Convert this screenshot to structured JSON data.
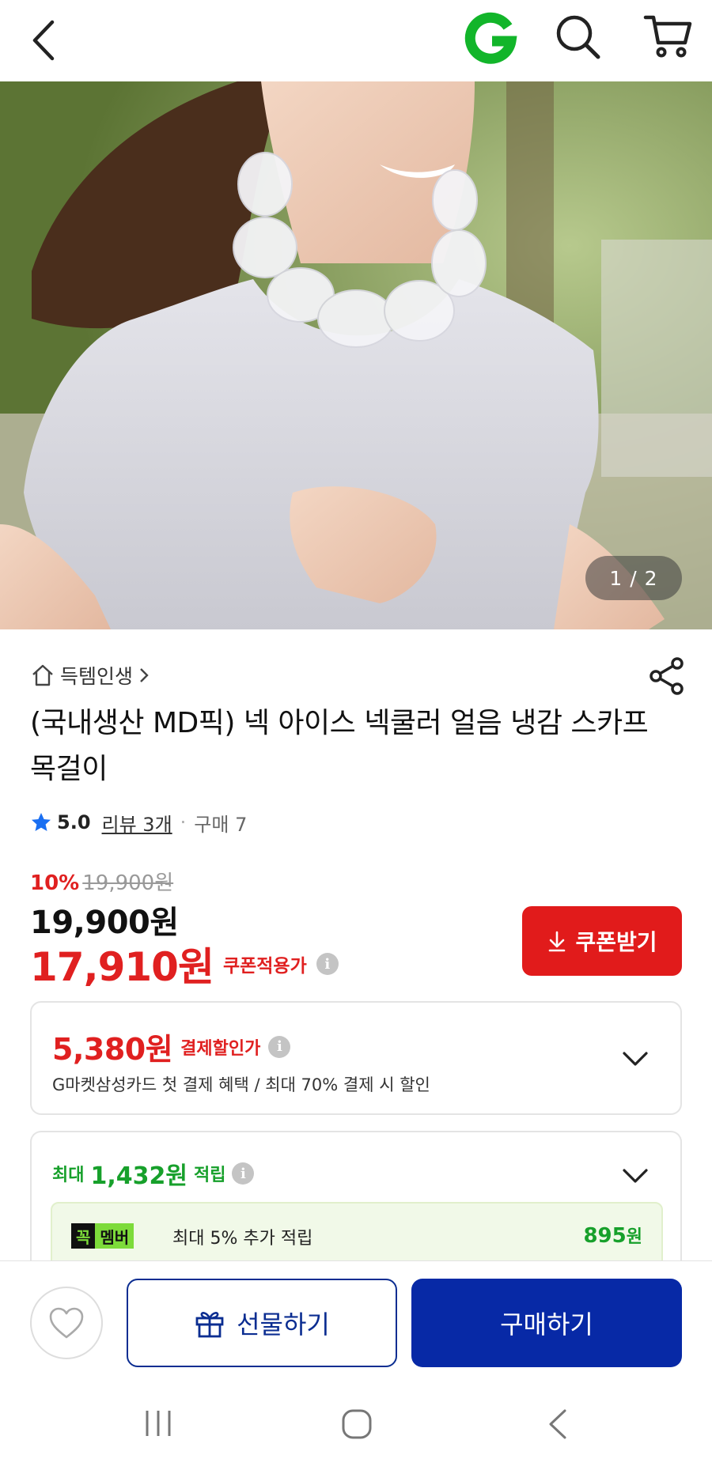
{
  "header": {
    "back_icon": "back-arrow-icon",
    "logo_icon": "g-logo-icon",
    "search_icon": "search-icon",
    "cart_icon": "cart-icon",
    "logo_color": "#12b52a"
  },
  "hero": {
    "counter": "1 / 2"
  },
  "seller": {
    "name": "득템인생",
    "home_icon": "home-icon",
    "share_icon": "share-icon"
  },
  "product": {
    "title": "(국내생산 MD픽) 넥 아이스 넥쿨러 얼음 냉감 스카프 목걸이"
  },
  "rating": {
    "score": "5.0",
    "reviews": "리뷰 3개",
    "separator": "·",
    "purchases": "구매 7"
  },
  "price": {
    "discount_rate": "10%",
    "original": "19,900원",
    "sale": "19,900원",
    "coupon_price": "17,910원",
    "coupon_label": "쿠폰적용가",
    "info_symbol": "i"
  },
  "coupon_button": {
    "label": "쿠폰받기",
    "icon": "download-icon"
  },
  "payment_discount": {
    "value": "5,380원",
    "label": "결제할인가",
    "description": "G마켓삼성카드 첫 결제 혜택 / 최대 70% 결제 시 할인"
  },
  "points": {
    "prefix": "최대",
    "value": "1,432원",
    "suffix": "적립",
    "member_badge_1": "꼭",
    "member_badge_2": "멤버",
    "member_desc": "최대 5% 추가 적립",
    "member_amount": "895",
    "member_unit": "원"
  },
  "bottom": {
    "wish_icon": "heart-icon",
    "gift_label": "선물하기",
    "gift_icon": "gift-icon",
    "buy_label": "구매하기",
    "primary_color": "#0729a6"
  },
  "system_nav": {
    "recent_icon": "recent-apps-icon",
    "home_icon": "home-circle-icon",
    "back_icon": "nav-back-icon"
  },
  "colors": {
    "red": "#e02020",
    "green": "#17a02b",
    "navy": "#0b2d91"
  }
}
